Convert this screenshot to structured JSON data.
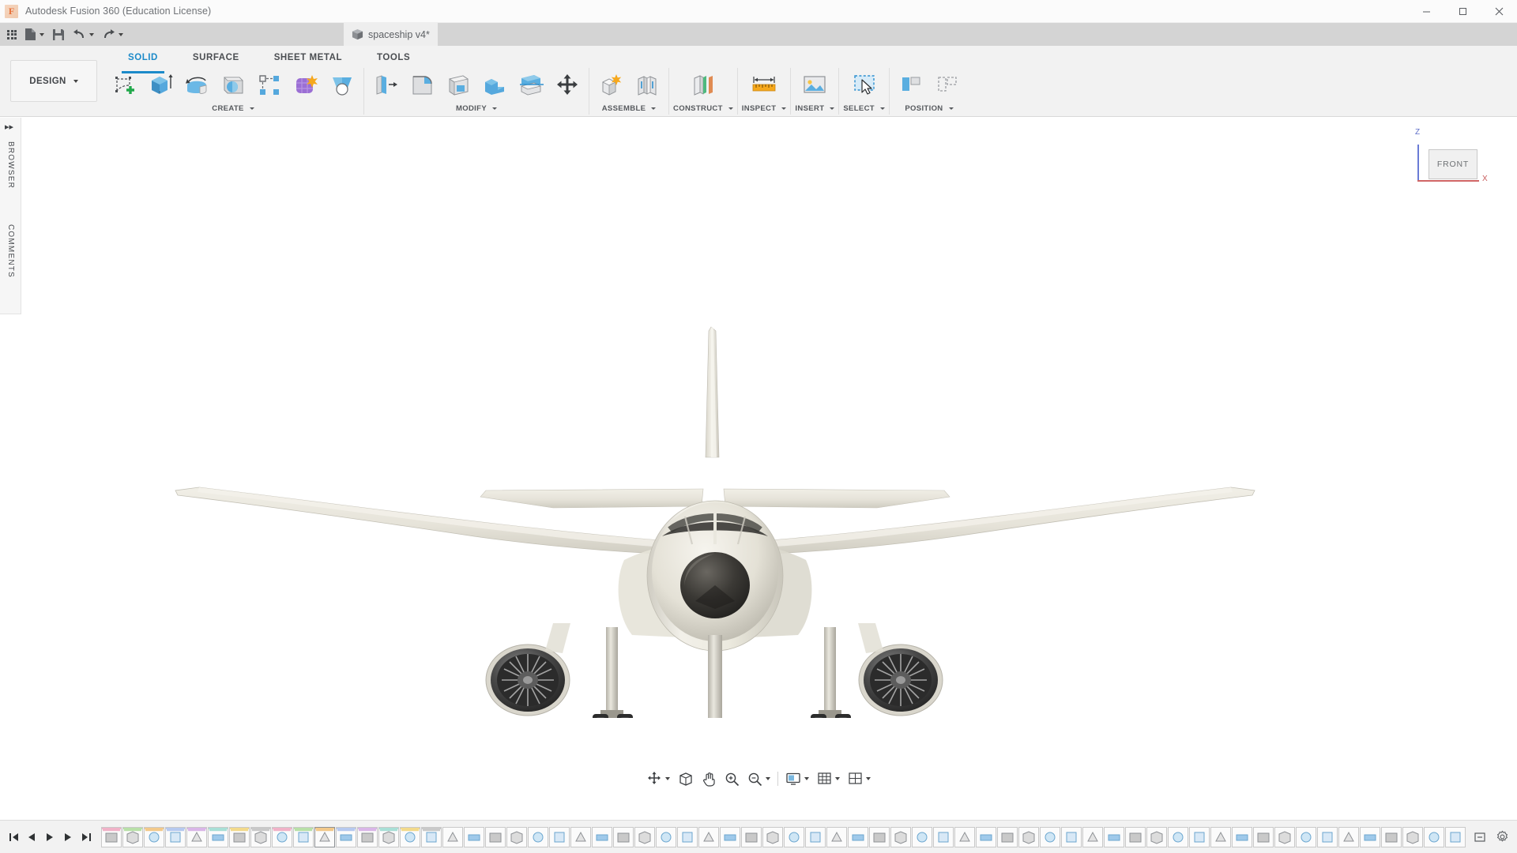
{
  "window": {
    "app_title": "Autodesk Fusion 360 (Education License)",
    "logo_letter": "F",
    "controls": {
      "minimize": "—",
      "maximize": "▢",
      "close": "✕"
    }
  },
  "quick_access": {
    "items": [
      {
        "name": "app-grid",
        "icon": "grid-icon",
        "label": ""
      },
      {
        "name": "new-file",
        "icon": "file-icon",
        "label": "",
        "has_caret": true
      },
      {
        "name": "save",
        "icon": "save-icon",
        "label": ""
      },
      {
        "name": "undo",
        "icon": "undo-icon",
        "label": "",
        "has_caret": true
      },
      {
        "name": "redo",
        "icon": "redo-icon",
        "label": "",
        "has_caret": true
      }
    ],
    "right_items": [
      {
        "name": "job-status",
        "icon": "compass-icon"
      },
      {
        "name": "recent-activity",
        "icon": "clock-icon"
      },
      {
        "name": "help",
        "icon": "question-icon"
      }
    ],
    "add_tab_label": "+",
    "close_tab_label": "✕"
  },
  "document": {
    "tab_label": "spaceship v4*",
    "tab_icon": "cube-icon"
  },
  "ribbon": {
    "design_dropdown": "DESIGN",
    "tabs": [
      {
        "label": "SOLID",
        "active": true
      },
      {
        "label": "SURFACE",
        "active": false
      },
      {
        "label": "SHEET METAL",
        "active": false
      },
      {
        "label": "TOOLS",
        "active": false
      }
    ],
    "panels": [
      {
        "label": "CREATE",
        "tools": [
          {
            "name": "create-sketch-tool",
            "icon": "sketch-plus-icon"
          },
          {
            "name": "extrude-tool",
            "icon": "extrude-icon"
          },
          {
            "name": "revolve-tool",
            "icon": "revolve-icon"
          },
          {
            "name": "sweep-tool",
            "icon": "sweep-icon"
          },
          {
            "name": "pattern-tool",
            "icon": "pattern-icon"
          },
          {
            "name": "form-tool",
            "icon": "form-icon"
          },
          {
            "name": "loft-tool",
            "icon": "loft-icon"
          }
        ]
      },
      {
        "label": "MODIFY",
        "tools": [
          {
            "name": "press-pull-tool",
            "icon": "press-pull-icon"
          },
          {
            "name": "fillet-tool",
            "icon": "fillet-icon"
          },
          {
            "name": "shell-tool",
            "icon": "shell-icon"
          },
          {
            "name": "combine-tool",
            "icon": "combine-icon"
          },
          {
            "name": "split-face-tool",
            "icon": "split-face-icon"
          },
          {
            "name": "move-copy-tool",
            "icon": "move-arrows-icon"
          }
        ]
      },
      {
        "label": "ASSEMBLE",
        "tools": [
          {
            "name": "new-component-tool",
            "icon": "new-component-icon"
          },
          {
            "name": "joint-tool",
            "icon": "joint-icon"
          }
        ]
      },
      {
        "label": "CONSTRUCT",
        "tools": [
          {
            "name": "offset-plane-tool",
            "icon": "offset-plane-icon"
          }
        ]
      },
      {
        "label": "INSPECT",
        "tools": [
          {
            "name": "measure-tool",
            "icon": "measure-ruler-icon"
          }
        ]
      },
      {
        "label": "INSERT",
        "tools": [
          {
            "name": "insert-image-tool",
            "icon": "image-icon"
          }
        ]
      },
      {
        "label": "SELECT",
        "tools": [
          {
            "name": "select-tool",
            "icon": "select-cursor-icon"
          }
        ]
      },
      {
        "label": "POSITION",
        "tools": [
          {
            "name": "align-left-tool",
            "icon": "align-left-icon"
          },
          {
            "name": "align-right-tool",
            "icon": "align-right-icon"
          }
        ]
      }
    ]
  },
  "left_dock": {
    "collapse_icon": "double-chevron-right-icon",
    "browser_label": "BROWSER",
    "comments_label": "COMMENTS"
  },
  "viewport": {
    "viewcube": {
      "face_label": "FRONT",
      "axis_z_label": "Z",
      "axis_x_label": "X",
      "axis_z_color": "#5f6fc8",
      "axis_x_color": "#c85c5c"
    },
    "model_name": "aircraft-front-view",
    "background_color": "#ffffff",
    "body_color": "#e9e6dd",
    "engine_color": "#3a3a3a"
  },
  "navbar": {
    "items": [
      {
        "name": "orbit-tool",
        "icon": "orbit-icon",
        "has_caret": true
      },
      {
        "name": "look-at-tool",
        "icon": "look-at-icon"
      },
      {
        "name": "pan-tool",
        "icon": "hand-icon"
      },
      {
        "name": "zoom-tool",
        "icon": "zoom-icon"
      },
      {
        "name": "zoom-window-tool",
        "icon": "zoom-window-icon",
        "has_caret": true
      },
      {
        "name": "display-settings",
        "icon": "display-icon",
        "has_caret": true
      },
      {
        "name": "grid-snaps",
        "icon": "grid-snap-icon",
        "has_caret": true
      },
      {
        "name": "viewports",
        "icon": "viewports-icon",
        "has_caret": true
      }
    ]
  },
  "timeline": {
    "playback": [
      {
        "name": "jump-to-beginning",
        "icon": "skip-back-icon"
      },
      {
        "name": "step-back",
        "icon": "prev-icon"
      },
      {
        "name": "play",
        "icon": "play-icon"
      },
      {
        "name": "step-forward",
        "icon": "next-icon"
      },
      {
        "name": "jump-to-end",
        "icon": "skip-forward-icon"
      }
    ],
    "node_count": 64,
    "right_items": [
      {
        "name": "timeline-overflow",
        "icon": "more-icon"
      },
      {
        "name": "settings",
        "icon": "gear-icon"
      }
    ]
  }
}
